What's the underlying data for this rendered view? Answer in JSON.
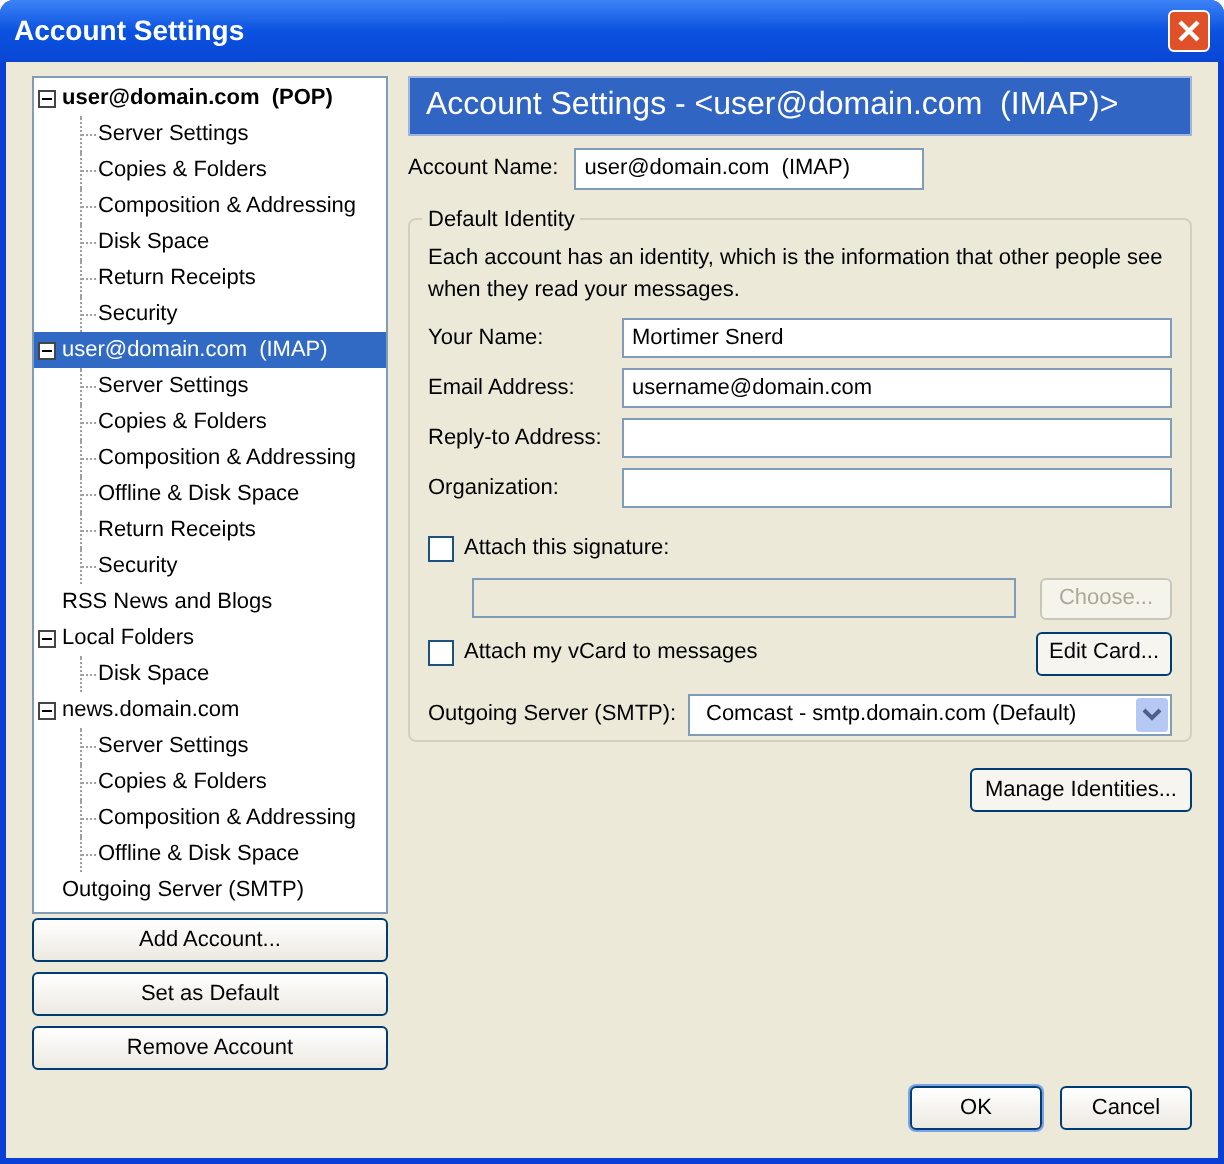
{
  "window": {
    "title": "Account Settings"
  },
  "tree": [
    {
      "label": "user@domain.com  (POP)",
      "default": true,
      "expanded": true,
      "selected": false,
      "children": [
        {
          "label": "Server Settings",
          "selected": false
        },
        {
          "label": "Copies & Folders",
          "selected": false
        },
        {
          "label": "Composition & Addressing",
          "selected": false
        },
        {
          "label": "Disk Space",
          "selected": false
        },
        {
          "label": "Return Receipts",
          "selected": false
        },
        {
          "label": "Security",
          "selected": false
        }
      ]
    },
    {
      "label": "user@domain.com  (IMAP)",
      "default": false,
      "expanded": true,
      "selected": true,
      "children": [
        {
          "label": "Server Settings",
          "selected": false
        },
        {
          "label": "Copies & Folders",
          "selected": false
        },
        {
          "label": "Composition & Addressing",
          "selected": false
        },
        {
          "label": "Offline & Disk Space",
          "selected": false
        },
        {
          "label": "Return Receipts",
          "selected": false
        },
        {
          "label": "Security",
          "selected": false
        }
      ]
    },
    {
      "label": "RSS News and Blogs",
      "default": false,
      "selected": false
    },
    {
      "label": "Local Folders",
      "default": false,
      "expanded": true,
      "selected": false,
      "children": [
        {
          "label": "Disk Space",
          "selected": false
        }
      ]
    },
    {
      "label": "news.domain.com",
      "default": false,
      "expanded": true,
      "selected": false,
      "children": [
        {
          "label": "Server Settings",
          "selected": false
        },
        {
          "label": "Copies & Folders",
          "selected": false
        },
        {
          "label": "Composition & Addressing",
          "selected": false
        },
        {
          "label": "Offline & Disk Space",
          "selected": false
        }
      ]
    },
    {
      "label": "Outgoing Server (SMTP)",
      "default": false,
      "selected": false
    }
  ],
  "tree_buttons": [
    "Add Account...",
    "Set as Default",
    "Remove Account"
  ],
  "header": "Account Settings - <user@domain.com  (IMAP)>",
  "account_name": {
    "label": "Account Name:",
    "value": "user@domain.com  (IMAP)"
  },
  "identity": {
    "legend": "Default Identity",
    "description": "Each account has an identity, which is the information that other people see when they read your messages.",
    "fields": [
      {
        "label": "Your Name:",
        "value": "Mortimer Snerd"
      },
      {
        "label": "Email Address:",
        "value": "username@domain.com"
      },
      {
        "label": "Reply-to Address:"
      },
      {
        "label": "Organization:"
      }
    ],
    "signature": {
      "label": "Attach this signature:",
      "checked": false,
      "button": "Choose...",
      "disabled": true
    },
    "vcard": {
      "label": "Attach my vCard to messages",
      "checked": false,
      "button": "Edit Card..."
    },
    "smtp": {
      "label": "Outgoing Server (SMTP):",
      "value": "Comcast - smtp.domain.com (Default)"
    }
  },
  "manage_button": "Manage Identities...",
  "buttons": [
    "OK",
    "Cancel"
  ]
}
